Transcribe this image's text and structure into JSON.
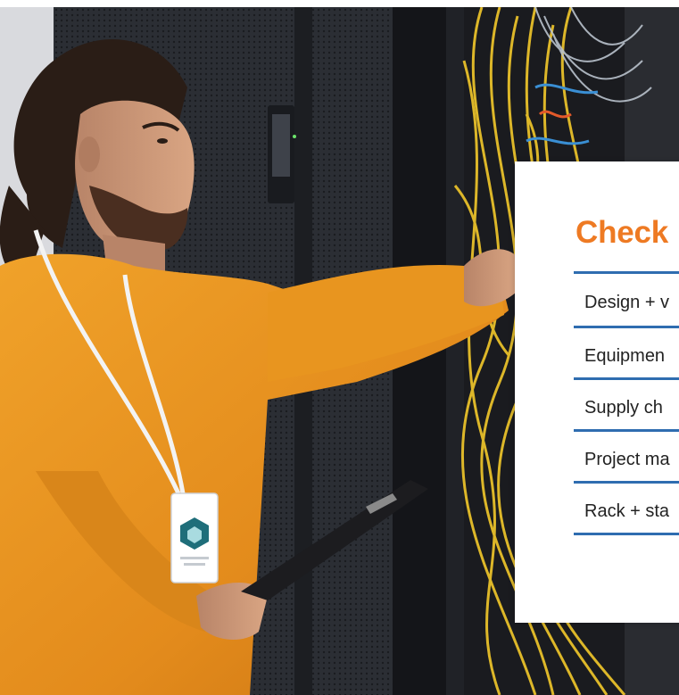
{
  "card": {
    "title": "Check",
    "items": [
      {
        "label": "Design + v"
      },
      {
        "label": "Equipmen"
      },
      {
        "label": "Supply ch"
      },
      {
        "label": "Project ma"
      },
      {
        "label": "Rack + sta"
      }
    ]
  },
  "colors": {
    "title_orange": "#ee7a23",
    "divider_blue": "#2f6db0",
    "sweater_orange": "#e8951f"
  },
  "icons": {
    "badge": "id-badge-icon"
  }
}
